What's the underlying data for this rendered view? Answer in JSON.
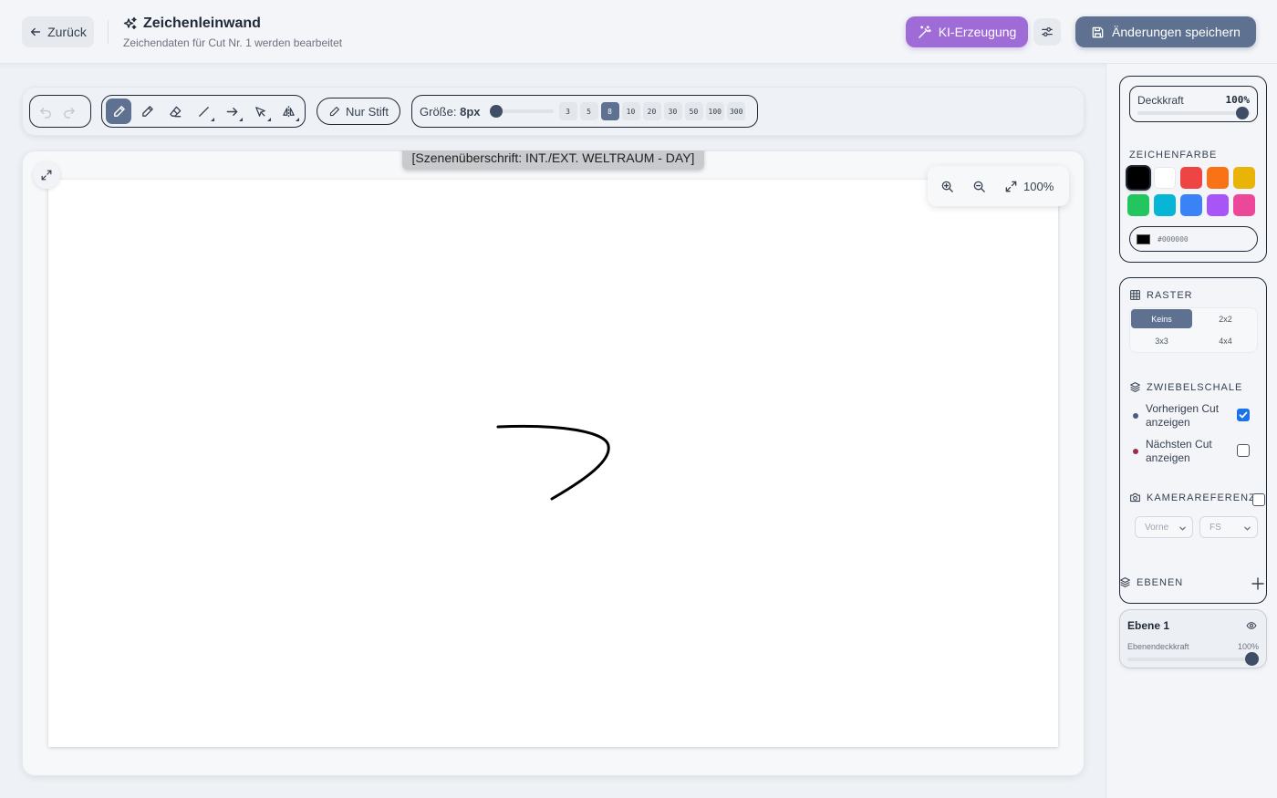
{
  "header": {
    "back_label": "Zurück",
    "title": "Zeichenleinwand",
    "subtitle": "Zeichendaten für Cut Nr. 1 werden bearbeitet",
    "ai_label": "KI-Erzeugung",
    "save_label": "Änderungen speichern",
    "accent_ai": "#9f6bd6",
    "accent_save": "#5f7190"
  },
  "toolbar": {
    "tools": [
      {
        "id": "brush",
        "icon": "brush-icon",
        "active": true
      },
      {
        "id": "pencil",
        "icon": "pencil-icon",
        "active": false
      },
      {
        "id": "eraser",
        "icon": "eraser-icon",
        "active": false
      },
      {
        "id": "line",
        "icon": "line-icon",
        "active": false
      },
      {
        "id": "arrow",
        "icon": "arrow-icon",
        "active": false
      },
      {
        "id": "select",
        "icon": "select-icon",
        "active": false
      },
      {
        "id": "mirror",
        "icon": "mirror-icon",
        "active": false
      }
    ],
    "pen_only_label": "Nur Stift",
    "size_label": "Größe:",
    "size_value": "8px",
    "size_presets": [
      "3",
      "5",
      "8",
      "10",
      "20",
      "30",
      "50",
      "100",
      "300"
    ],
    "size_active": "8"
  },
  "canvas": {
    "scene_heading": "[Szenenüberschrift: INT./EXT. WELTRAUM - DAY]",
    "zoom": "100%"
  },
  "sidebar": {
    "opacity_label": "Deckkraft",
    "opacity_value": "100%",
    "color_title": "ZEICHENFARBE",
    "colors": [
      "#000000",
      "#ffffff",
      "#ef4444",
      "#f97316",
      "#eab308",
      "#22c55e",
      "#06b6d4",
      "#3b82f6",
      "#a855f7",
      "#ec4899"
    ],
    "selected_color": "#000000",
    "hex_value": "#000000",
    "grid_title": "RASTER",
    "grid_options": [
      "Keins",
      "2x2",
      "3x3",
      "4x4"
    ],
    "grid_active": "Keins",
    "onion_title": "ZWIEBELSCHALE",
    "onion_prev": "Vorherigen Cut anzeigen",
    "onion_next": "Nächsten Cut anzeigen",
    "onion_prev_color": "#4a5a80",
    "onion_next_color": "#9b2c4a",
    "camera_title": "KAMERAREFERENZ",
    "camera_view": "Vorne",
    "camera_shot": "FS",
    "layers_title": "EBENEN",
    "layer_name": "Ebene 1",
    "layer_opacity_label": "Ebenendeckkraft",
    "layer_opacity_value": "100%"
  }
}
